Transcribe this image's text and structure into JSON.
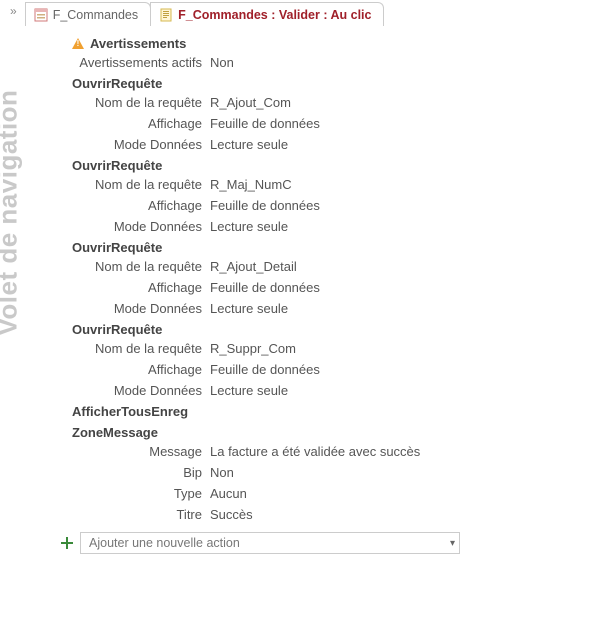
{
  "navToggleGlyph": "»",
  "navPane": {
    "label": "Volet de navigation"
  },
  "tabs": [
    {
      "label": "F_Commandes",
      "icon": "form-icon",
      "active": false
    },
    {
      "label": "F_Commandes : Valider : Au clic",
      "icon": "macro-icon",
      "active": true
    }
  ],
  "warnings": {
    "header": "Avertissements",
    "labelActive": "Avertissements actifs",
    "valueActive": "Non"
  },
  "actions": [
    {
      "name": "OuvrirRequête",
      "params": [
        {
          "label": "Nom de la requête",
          "value": "R_Ajout_Com"
        },
        {
          "label": "Affichage",
          "value": "Feuille de données"
        },
        {
          "label": "Mode Données",
          "value": "Lecture seule"
        }
      ]
    },
    {
      "name": "OuvrirRequête",
      "params": [
        {
          "label": "Nom de la requête",
          "value": "R_Maj_NumC"
        },
        {
          "label": "Affichage",
          "value": "Feuille de données"
        },
        {
          "label": "Mode Données",
          "value": "Lecture seule"
        }
      ]
    },
    {
      "name": "OuvrirRequête",
      "params": [
        {
          "label": "Nom de la requête",
          "value": "R_Ajout_Detail"
        },
        {
          "label": "Affichage",
          "value": "Feuille de données"
        },
        {
          "label": "Mode Données",
          "value": "Lecture seule"
        }
      ]
    },
    {
      "name": "OuvrirRequête",
      "params": [
        {
          "label": "Nom de la requête",
          "value": "R_Suppr_Com"
        },
        {
          "label": "Affichage",
          "value": "Feuille de données"
        },
        {
          "label": "Mode Données",
          "value": "Lecture seule"
        }
      ]
    },
    {
      "name": "AfficherTousEnreg",
      "params": []
    },
    {
      "name": "ZoneMessage",
      "params": [
        {
          "label": "Message",
          "value": "La facture a été validée avec succès"
        },
        {
          "label": "Bip",
          "value": "Non"
        },
        {
          "label": "Type",
          "value": "Aucun"
        },
        {
          "label": "Titre",
          "value": "Succès"
        }
      ]
    }
  ],
  "newAction": {
    "placeholder": "Ajouter une nouvelle action"
  }
}
